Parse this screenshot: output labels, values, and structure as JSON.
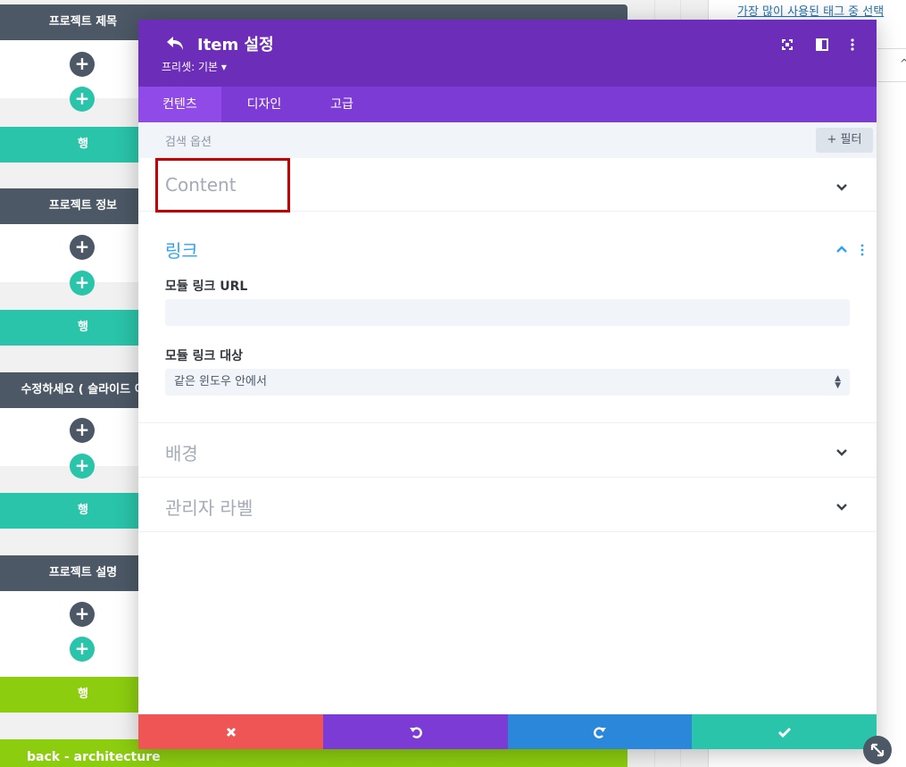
{
  "background": {
    "tag_link": "가장 많이 사용된 태그 중 선택",
    "modules": [
      {
        "title": "프로젝트 제목",
        "row_label": "행",
        "row_color": "#29c4a9"
      },
      {
        "title": "프로젝트 정보",
        "row_label": "행",
        "row_color": "#29c4a9"
      },
      {
        "title": "수정하세요 ( 슬라이드 이",
        "row_label": "행",
        "row_color": "#29c4a9"
      },
      {
        "title": "프로젝트 설명",
        "row_label": "행",
        "row_color": "#8ccd0f"
      }
    ],
    "add_symbol": "+",
    "back_label": "back - architecture"
  },
  "modal": {
    "title": "Item 설정",
    "preset": "프리셋: 기본 ▾",
    "tabs": [
      {
        "label": "컨텐츠",
        "active": true
      },
      {
        "label": "디자인",
        "active": false
      },
      {
        "label": "고급",
        "active": false
      }
    ],
    "search": {
      "placeholder": "검색 옵션",
      "filter_label": "+ 필터"
    },
    "sections": {
      "content": {
        "title": "Content",
        "open": false
      },
      "link": {
        "title": "링크",
        "open": true,
        "url_label": "모듈 링크 URL",
        "url_value": "",
        "target_label": "모듈 링크 대상",
        "target_value": "같은 윈도우 안에서"
      },
      "background": {
        "title": "배경",
        "open": false
      },
      "admin_label": {
        "title": "관리자 라벨",
        "open": false
      }
    }
  },
  "colors": {
    "header": "#6c2eb9",
    "tabs": "#7d3bd6",
    "tab_active": "#8f4ae8",
    "cancel": "#ef5555",
    "undo": "#7d3bd6",
    "redo": "#2b87da",
    "save": "#29c4a9",
    "highlight": "#c00000"
  }
}
